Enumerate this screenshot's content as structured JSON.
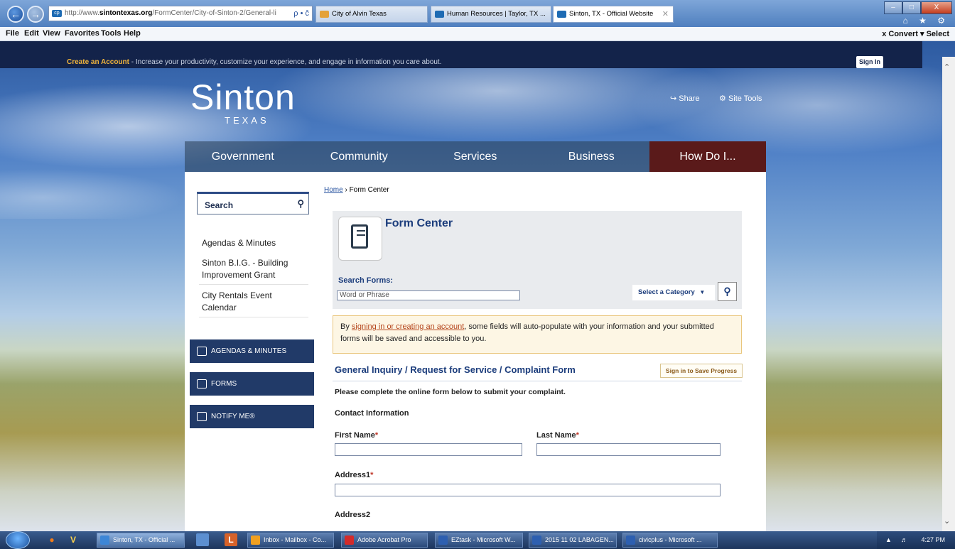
{
  "browser": {
    "address": "http://www.sintontexas.org/FormCenter/City-of-Sinton-2/General-li",
    "address_prefix": "http://www.",
    "address_domain": "sintontexas.org",
    "address_path": "/FormCenter/City-of-Sinton-2/General-li",
    "address_tools": "ρ • ĉ",
    "tabs": [
      {
        "label": "City of Alvin Texas"
      },
      {
        "label": "Human Resources | Taylor, TX ..."
      },
      {
        "label": "Sinton, TX - Official Website"
      }
    ],
    "window_controls": [
      "–",
      "□",
      "X"
    ],
    "fav_icons": "⌂ ★ ⚙",
    "menu": [
      "File",
      "Edit",
      "View",
      "Favorites",
      "Tools",
      "Help"
    ],
    "menu_right": "x  Convert ▾  Select"
  },
  "site": {
    "create_account_link": "Create an Account",
    "create_account_text": " - Increase your productivity, customize your experience, and engage in information you care about.",
    "signin_label": "Sign In",
    "logo_name": "Sinton",
    "logo_sub": "TEXAS",
    "share_label": "Share",
    "site_tools_label": "Site Tools",
    "nav": [
      "Government",
      "Community",
      "Services",
      "Business",
      "How Do I..."
    ]
  },
  "sidebar": {
    "search_label": "Search",
    "links": [
      {
        "label": "Agendas & Minutes"
      },
      {
        "label": "Sinton B.I.G. - Building Improvement Grant"
      },
      {
        "label": "City Rentals Event Calendar"
      }
    ],
    "buttons": [
      {
        "label": "AGENDAS & MINUTES"
      },
      {
        "label": "FORMS"
      },
      {
        "label": "NOTIFY ME®"
      }
    ]
  },
  "main": {
    "breadcrumb_home": "Home",
    "breadcrumb_sep": " › ",
    "breadcrumb_current": "Form Center",
    "form_center_title": "Form Center",
    "search_forms_label": "Search Forms:",
    "search_placeholder": "Word or Phrase",
    "category_label": "Select a Category",
    "notice_pre": "By ",
    "notice_link": "signing in or creating an account",
    "notice_post": ", some fields will auto-populate with your information and your submitted forms will be saved and accessible to you.",
    "form_title": "General Inquiry / Request for Service / Complaint Form",
    "save_progress_label": "Sign in to Save Progress",
    "form_intro": "Please complete the online form below to submit your complaint.",
    "contact_heading": "Contact Information",
    "fields": {
      "first_name": "First Name",
      "last_name": "Last Name",
      "address1": "Address1",
      "address2": "Address2",
      "required_mark": "*"
    }
  },
  "taskbar": {
    "quick": [
      "V"
    ],
    "items": [
      {
        "label": "Sinton, TX - Official ..."
      },
      {
        "label": "Inbox - Mailbox - Co..."
      },
      {
        "label": "Adobe Acrobat Pro"
      },
      {
        "label": "EZtask - Microsoft W..."
      },
      {
        "label": "2015 11 02 LABAGEN..."
      },
      {
        "label": "civicplus - Microsoft ..."
      }
    ],
    "clock": "4:27 PM"
  }
}
